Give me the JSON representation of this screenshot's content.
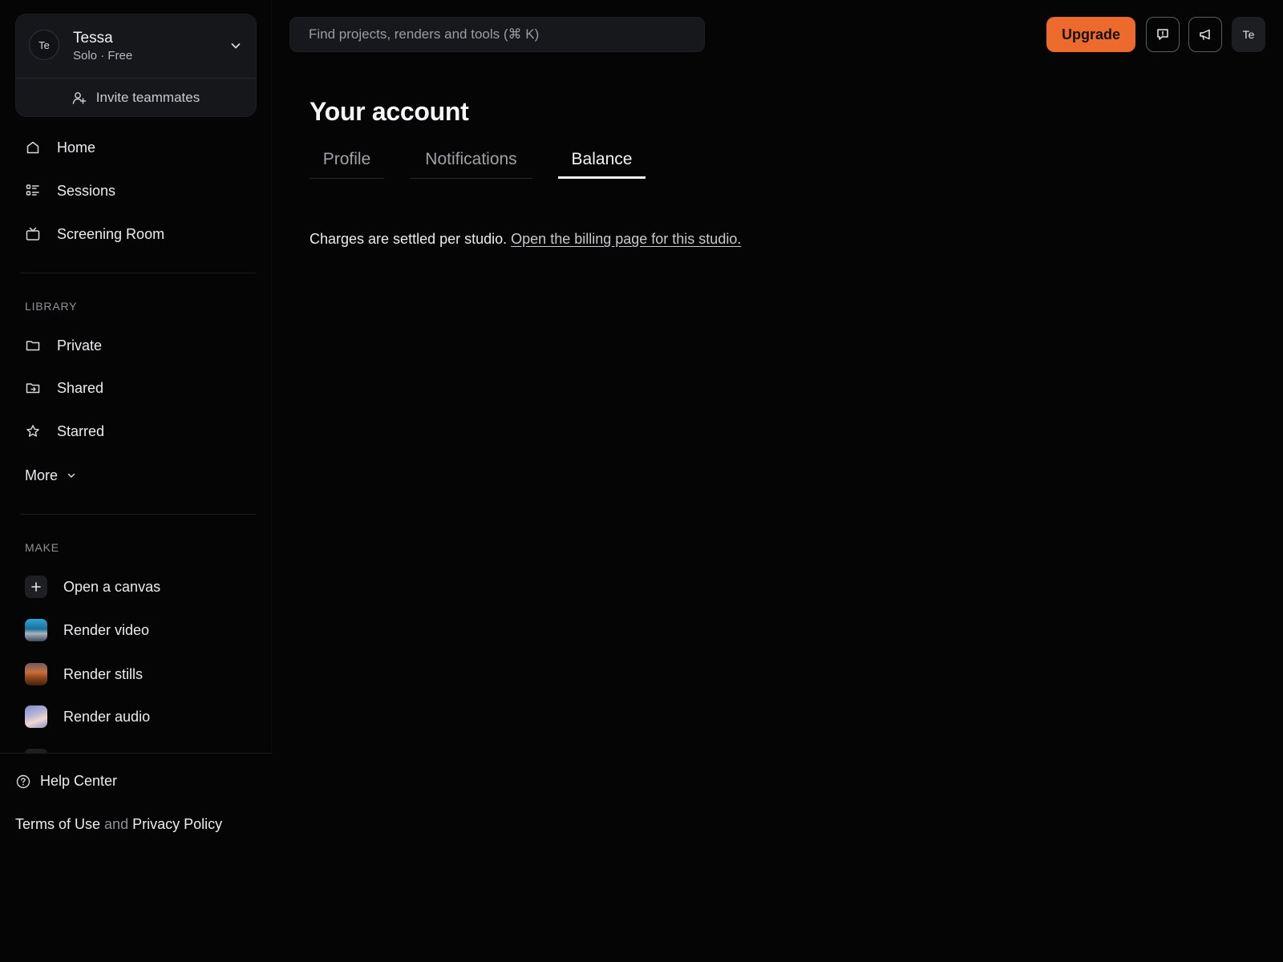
{
  "account": {
    "initials": "Te",
    "name": "Tessa",
    "plan": "Solo · Free",
    "invite_label": "Invite teammates"
  },
  "nav": {
    "items": [
      {
        "label": "Home",
        "icon": "home-icon"
      },
      {
        "label": "Sessions",
        "icon": "list-icon"
      },
      {
        "label": "Screening Room",
        "icon": "tv-icon"
      }
    ]
  },
  "library": {
    "heading": "LIBRARY",
    "items": [
      {
        "label": "Private",
        "icon": "folder-icon"
      },
      {
        "label": "Shared",
        "icon": "shared-folder-icon"
      },
      {
        "label": "Starred",
        "icon": "star-icon"
      }
    ],
    "more_label": "More"
  },
  "make": {
    "heading": "MAKE",
    "items": [
      {
        "label": "Open a canvas",
        "icon": "plus-icon"
      },
      {
        "label": "Render video",
        "icon": "video-thumbnail"
      },
      {
        "label": "Render stills",
        "icon": "stills-thumbnail"
      },
      {
        "label": "Render audio",
        "icon": "audio-thumbnail"
      }
    ]
  },
  "footer": {
    "help_label": "Help Center",
    "terms_label": "Terms of Use",
    "and_text": "and",
    "privacy_label": "Privacy Policy"
  },
  "topbar": {
    "search_placeholder": "Find projects, renders and tools (⌘ K)",
    "upgrade_label": "Upgrade",
    "avatar_initials": "Te"
  },
  "main": {
    "title": "Your account",
    "tabs": [
      {
        "label": "Profile",
        "active": false
      },
      {
        "label": "Notifications",
        "active": false
      },
      {
        "label": "Balance",
        "active": true
      }
    ],
    "note_text": "Charges are settled per studio.",
    "note_link": "Open the billing page for this studio."
  },
  "colors": {
    "background": "#050506",
    "accent": "#ec6a2c",
    "panel": "#15171a"
  }
}
